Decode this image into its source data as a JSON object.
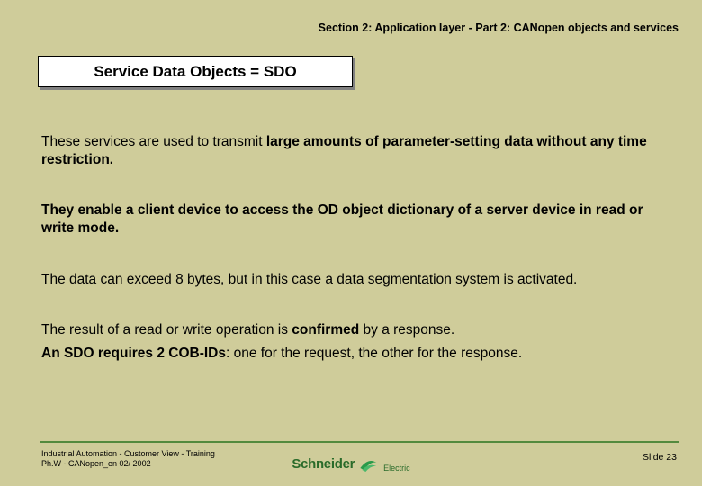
{
  "header": {
    "section": "Section 2: Application layer - Part 2: CANopen objects and services"
  },
  "title": "Service Data Objects = SDO",
  "body": {
    "p1_pre": "These services are used to transmit ",
    "p1_bold": "large amounts of parameter-setting data without any time restriction.",
    "p2": "They enable a client device to access the OD object dictionary of a server device in read or write mode.",
    "p3": "The data can exceed 8 bytes, but in this case a data segmentation system is activated.",
    "p4_pre": "The result of a read or write operation is ",
    "p4_bold": "confirmed",
    "p4_post": " by a response.",
    "p5_bold": "An SDO requires 2 COB-IDs",
    "p5_post": ": one for the request, the other for the response."
  },
  "footer": {
    "line1": "Industrial Automation -  Customer View -  Training",
    "line2": "Ph.W - CANopen_en  02/ 2002",
    "slide": "Slide 23",
    "logo_main": "Schneider",
    "logo_sub": "Electric"
  }
}
